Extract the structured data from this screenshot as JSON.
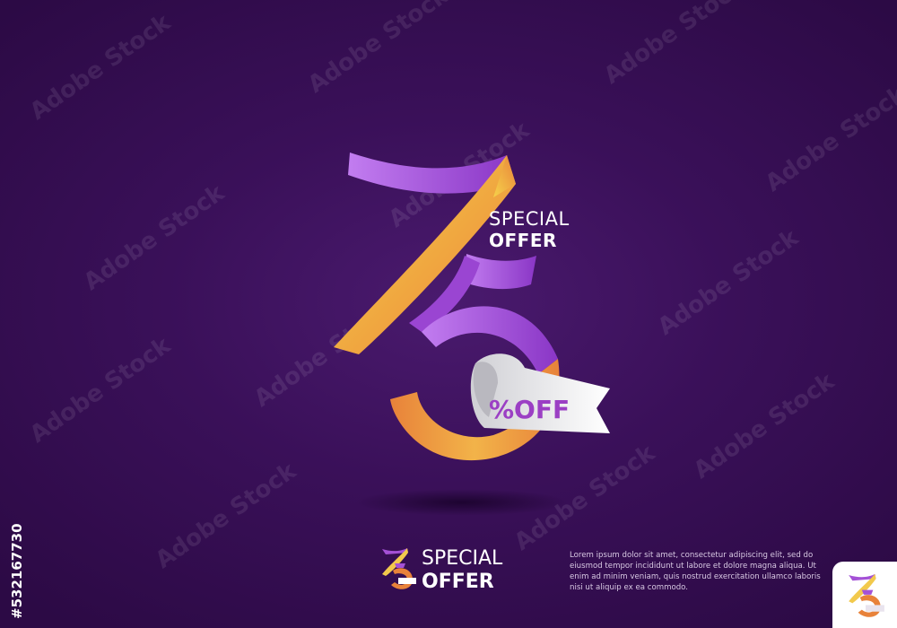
{
  "hero": {
    "special_label": "SPECIAL",
    "offer_label": "OFFER",
    "ribbon_label": "%OFF"
  },
  "footer": {
    "special_label": "SPECIAL",
    "offer_label": "OFFER",
    "description": "Lorem ipsum dolor sit amet, consectetur adipiscing elit, sed do eiusmod tempor incididunt ut labore et dolore magna aliqua. Ut enim ad minim veniam, quis nostrud exercitation ullamco laboris nisi ut aliquip ex ea commodo."
  },
  "stock": {
    "watermark": "Adobe Stock",
    "image_id": "#532167730"
  },
  "colors": {
    "background": "#3a1059",
    "purple": "#a451d6",
    "gold": "#f2c94c",
    "orange": "#e8823a"
  }
}
